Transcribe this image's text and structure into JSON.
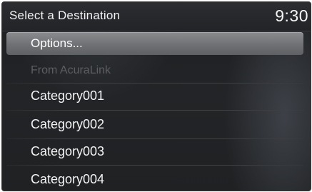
{
  "header": {
    "title": "Select a Destination",
    "clock": "9:30"
  },
  "menu": {
    "items": [
      {
        "label": "Options...",
        "state": "selected"
      },
      {
        "label": "From AcuraLink",
        "state": "disabled"
      },
      {
        "label": "Category001",
        "state": "normal"
      },
      {
        "label": "Category002",
        "state": "normal"
      },
      {
        "label": "Category003",
        "state": "normal"
      },
      {
        "label": "Category004",
        "state": "normal"
      }
    ]
  },
  "colors": {
    "background": "#212326",
    "highlight": "#7a7c7f",
    "text": "#f4f4f4",
    "disabled_text": "#5c5e61"
  }
}
